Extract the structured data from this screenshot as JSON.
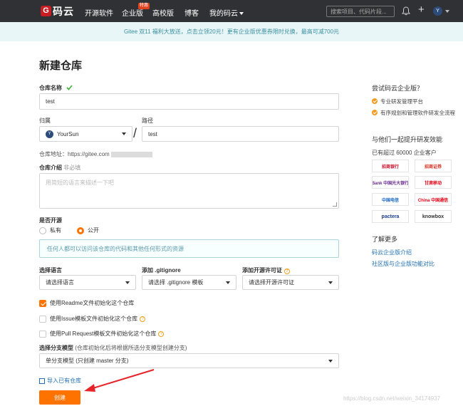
{
  "nav": {
    "logo_mark": "G",
    "logo_text": "码云",
    "items": [
      "开源软件",
      "企业版",
      "高校版",
      "博客",
      "我的码云"
    ],
    "badge": "特惠",
    "search_placeholder": "搜索项目、代码片段...",
    "avatar": "Y"
  },
  "banner": "Gitee 双11 福利大放送，点击立领20元！更有企业版优惠券限时兑换，最高可减700元",
  "form": {
    "title": "新建仓库",
    "name_label": "仓库名称",
    "name_value": "test",
    "owner_label": "归属",
    "owner_value": "YourSun",
    "owner_avatar": "Y",
    "slash": "/",
    "path_label": "路径",
    "path_value": "test",
    "address_label": "仓库地址：https://gitee.com",
    "desc_label": "仓库介绍",
    "desc_optional": "非必填",
    "desc_placeholder": "用简短的语言来描述一下吧",
    "open_label": "是否开源",
    "private_label": "私有",
    "public_label": "公开",
    "public_notice": "任何人都可以访问该仓库的代码和其他任何形式的资源",
    "lang_label": "选择语言",
    "lang_value": "请选择语言",
    "gitignore_label": "添加 .gitignore",
    "gitignore_value": "请选择 .gitignore 模板",
    "license_label": "添加开源许可证",
    "license_value": "请选择开源许可证",
    "readme_label": "使用Readme文件初始化这个仓库",
    "issue_label": "使用Issue模板文件初始化这个仓库",
    "pr_label": "使用Pull Request模板文件初始化这个仓库",
    "branch_label": "选择分支模型",
    "branch_hint": "(仓库初始化后将根据所选分支模型创建分支)",
    "branch_value": "单分支模型 (只创建 master 分支)",
    "import_label": "导入已有仓库",
    "create_label": "创建"
  },
  "sidebar": {
    "enterprise_title": "尝试码云企业版？",
    "features": [
      "专业研发管理平台",
      "有序规划和管理软件研发全流程"
    ],
    "improve_title": "与他们一起提升研发效能",
    "customers_text": "已有超过 60000 企业客户",
    "logos": [
      "招商银行",
      "招商证券",
      "Bank 中国光大银行",
      "甘肃移动",
      "中国电信",
      "China 中国通信",
      "pactera",
      "knowbox"
    ],
    "more_title": "了解更多",
    "links": [
      "码云企业版介绍",
      "社区版与企业版功能对比"
    ]
  },
  "watermark": "https://blog.csdn.net/weixin_34174937",
  "colors": {
    "accent": "#fe7300",
    "nav_bg": "#2f3135",
    "link": "#1f6fb2"
  }
}
